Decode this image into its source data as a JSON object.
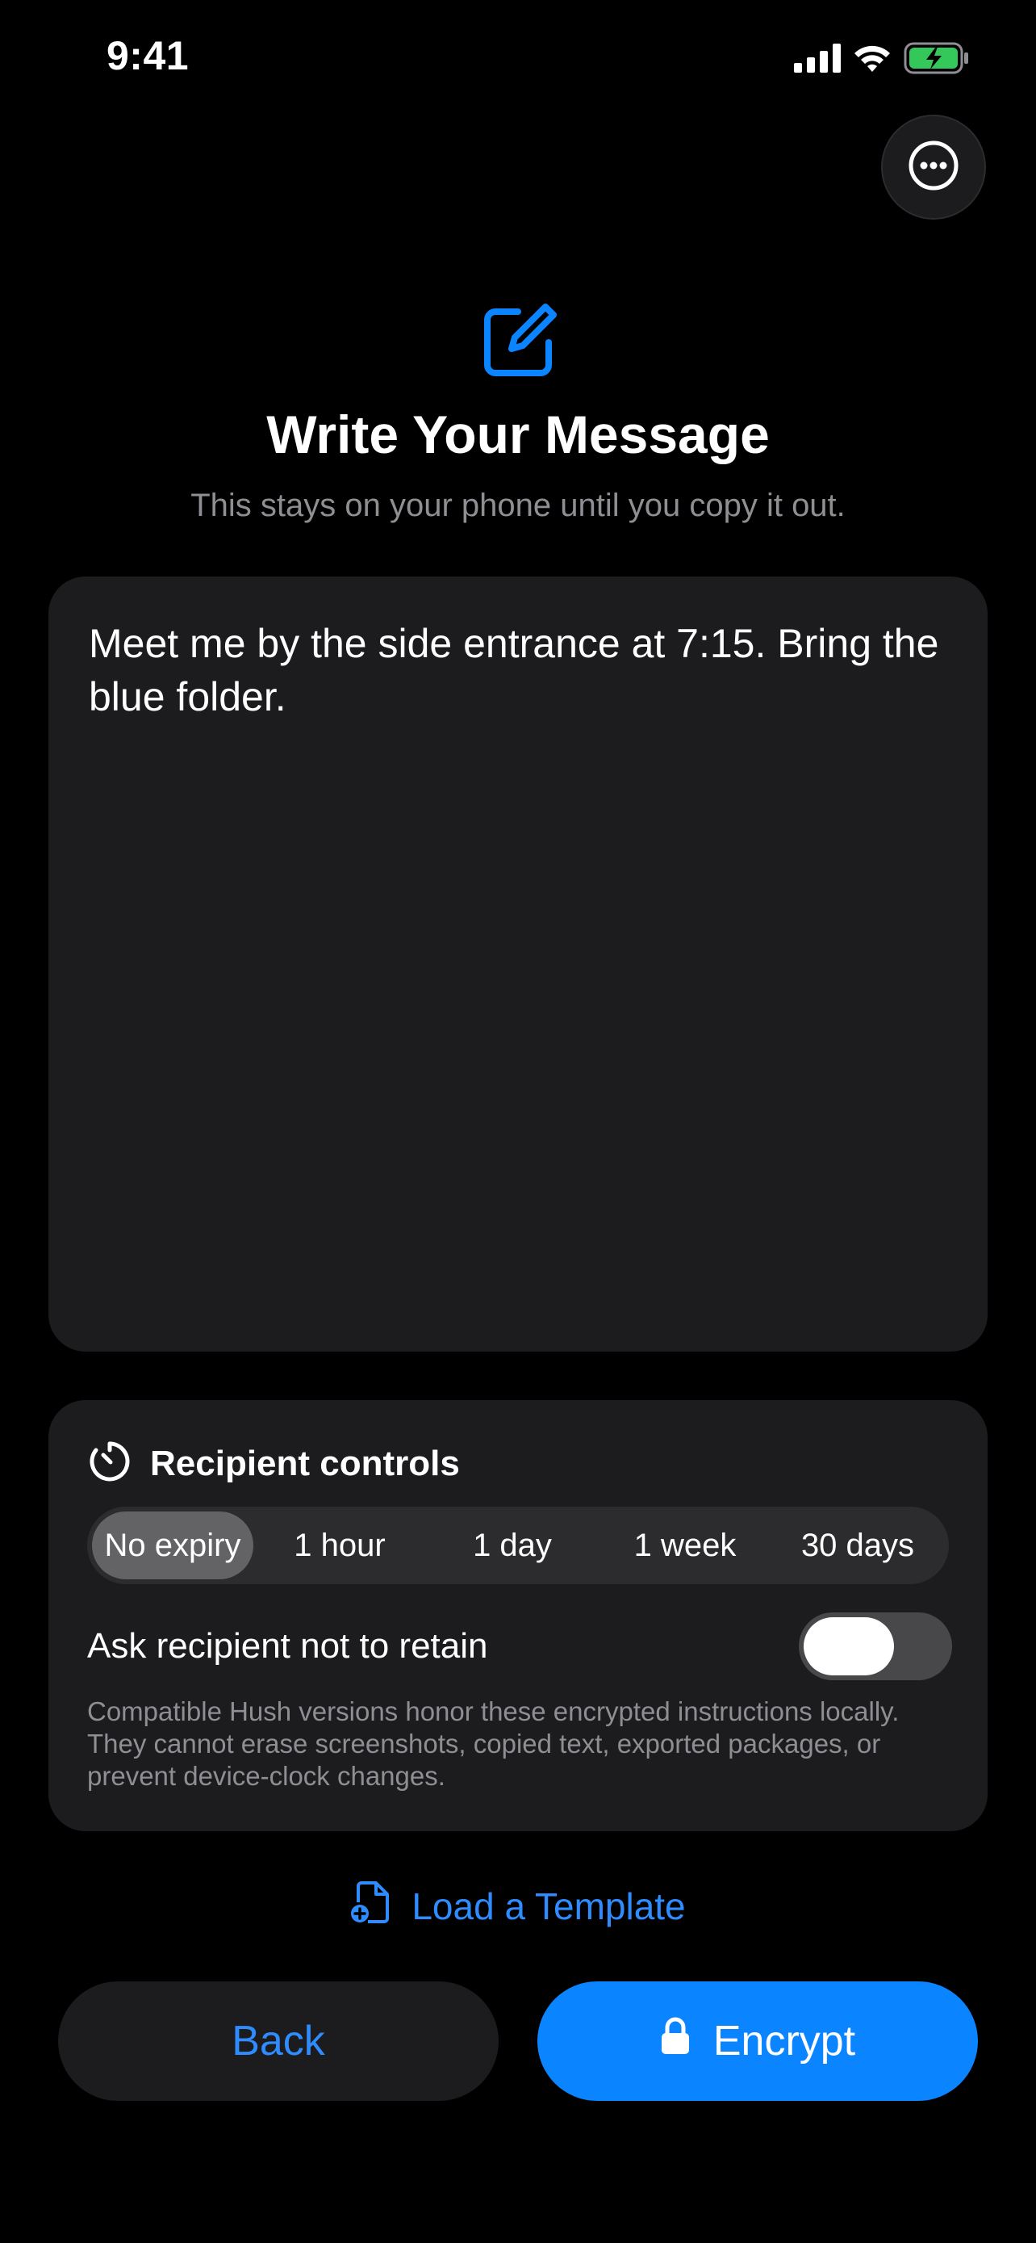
{
  "status_bar": {
    "time": "9:41",
    "icons": [
      "cellular-signal-icon",
      "wifi-icon",
      "battery-charging-icon"
    ]
  },
  "header": {
    "more_button_icon": "ellipsis-circle-icon",
    "compose_icon": "compose-square-pencil-icon",
    "title": "Write Your Message",
    "subtitle": "This stays on your phone until you copy it out."
  },
  "message": {
    "text": "Meet me by the side entrance at 7:15. Bring the blue folder."
  },
  "recipient_controls": {
    "icon": "timer-icon",
    "title": "Recipient controls",
    "expiry_options": [
      "No expiry",
      "1 hour",
      "1 day",
      "1 week",
      "30 days"
    ],
    "selected_expiry": "No expiry",
    "retain_label": "Ask recipient not to retain",
    "retain_toggle_on": false,
    "disclaimer": "Compatible Hush versions honor these encrypted instructions locally. They cannot erase screenshots, copied text, exported packages, or prevent device-clock changes."
  },
  "template_link": {
    "icon": "document-add-icon",
    "label": "Load a Template"
  },
  "actions": {
    "back_label": "Back",
    "encrypt_label": "Encrypt",
    "encrypt_icon": "lock-icon"
  },
  "colors": {
    "background": "#000000",
    "card": "#1c1c1e",
    "accent": "#0a84ff",
    "link": "#2f8cff",
    "secondary_text": "#8e8e93"
  }
}
